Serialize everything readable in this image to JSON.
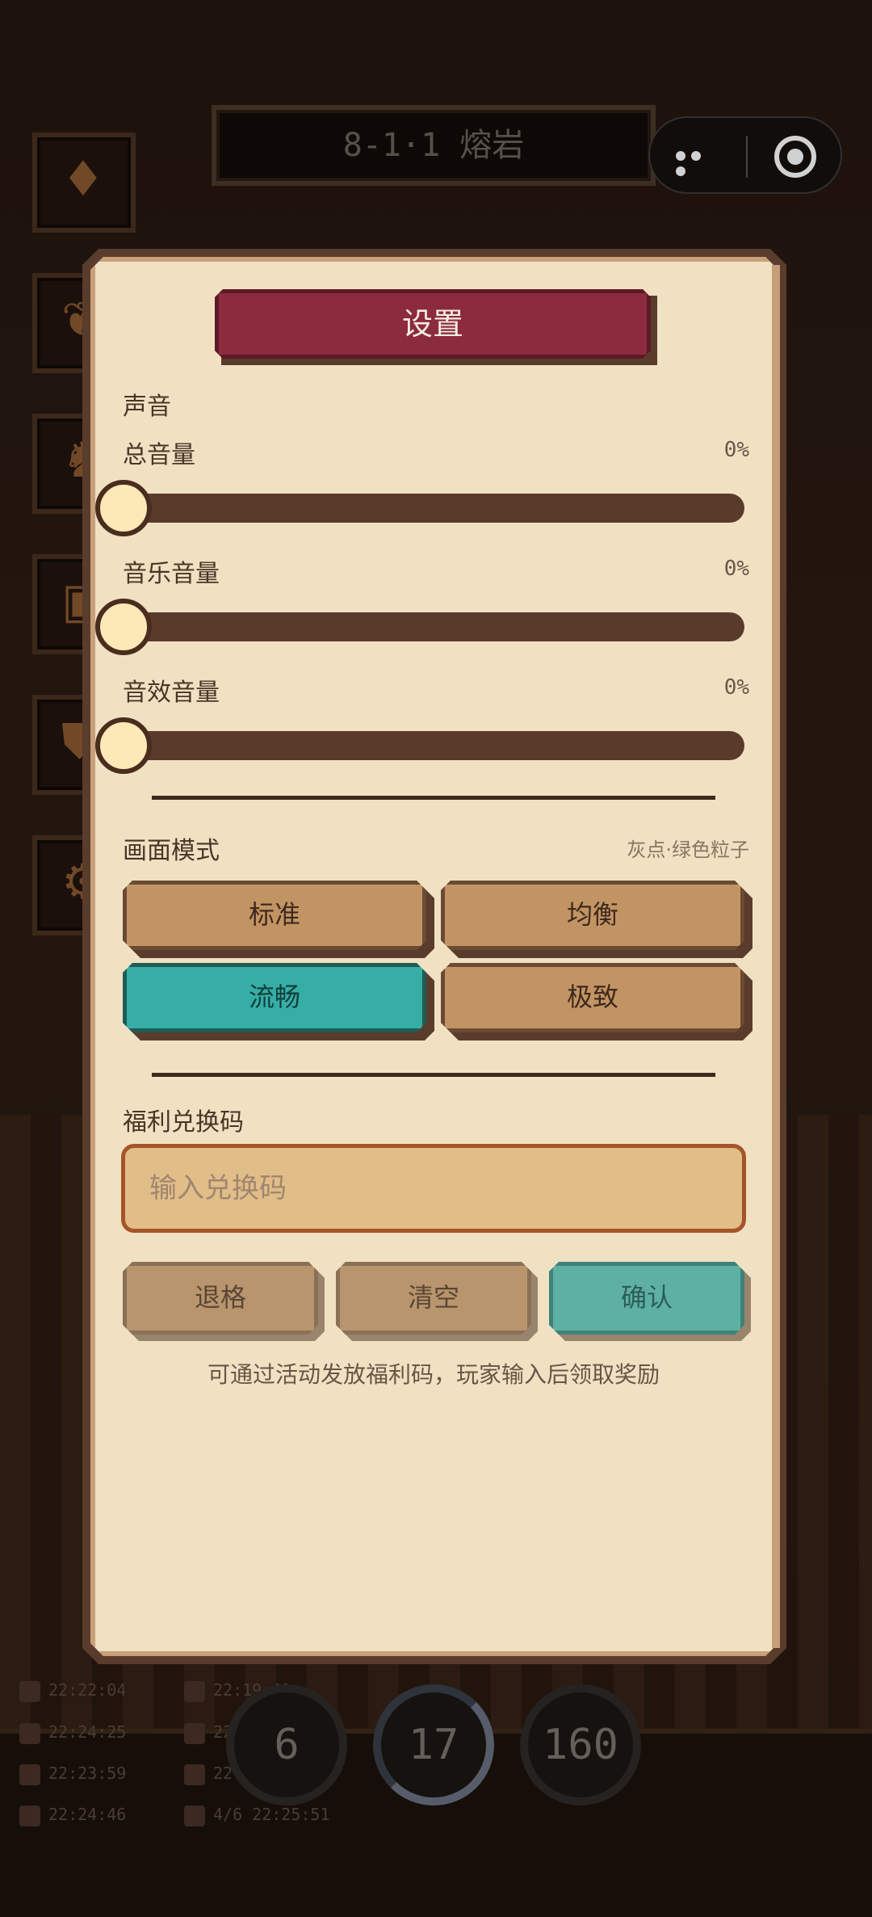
{
  "background": {
    "stage_title": "8-1·1 熔岩",
    "left_icons": [
      "bag-icon",
      "wing-icon",
      "figure-icon",
      "chest-icon",
      "shield-icon",
      "gear-icon"
    ],
    "logs": [
      {
        "time": "22:22:04"
      },
      {
        "time": "22:19:49"
      },
      {
        "time": "22:24:25"
      },
      {
        "time": "22:25:1"
      },
      {
        "time": "22:23:59"
      },
      {
        "time": "22:25:28"
      },
      {
        "time": "22:24:46"
      },
      {
        "time": "4/6 22:25:51"
      }
    ],
    "gauges": [
      "6",
      "17",
      "160"
    ]
  },
  "settings": {
    "title": "设置",
    "sound_section": "声音",
    "sliders": [
      {
        "label": "总音量",
        "value": "0%"
      },
      {
        "label": "音乐音量",
        "value": "0%"
      },
      {
        "label": "音效音量",
        "value": "0%"
      }
    ],
    "display_section": "画面模式",
    "display_hint": "灰点·绿色粒子",
    "modes": [
      {
        "label": "标准",
        "active": false
      },
      {
        "label": "均衡",
        "active": false
      },
      {
        "label": "流畅",
        "active": true
      },
      {
        "label": "极致",
        "active": false
      }
    ],
    "code_section": "福利兑换码",
    "code_placeholder": "输入兑换码",
    "code_value": "",
    "buttons": {
      "backspace": "退格",
      "clear": "清空",
      "confirm": "确认"
    },
    "hint": "可通过活动发放福利码，玩家输入后领取奖励"
  },
  "colors": {
    "title_button": "#8c2a3e",
    "active_mode": "#36aea6",
    "panel": "#f0e1c3"
  }
}
